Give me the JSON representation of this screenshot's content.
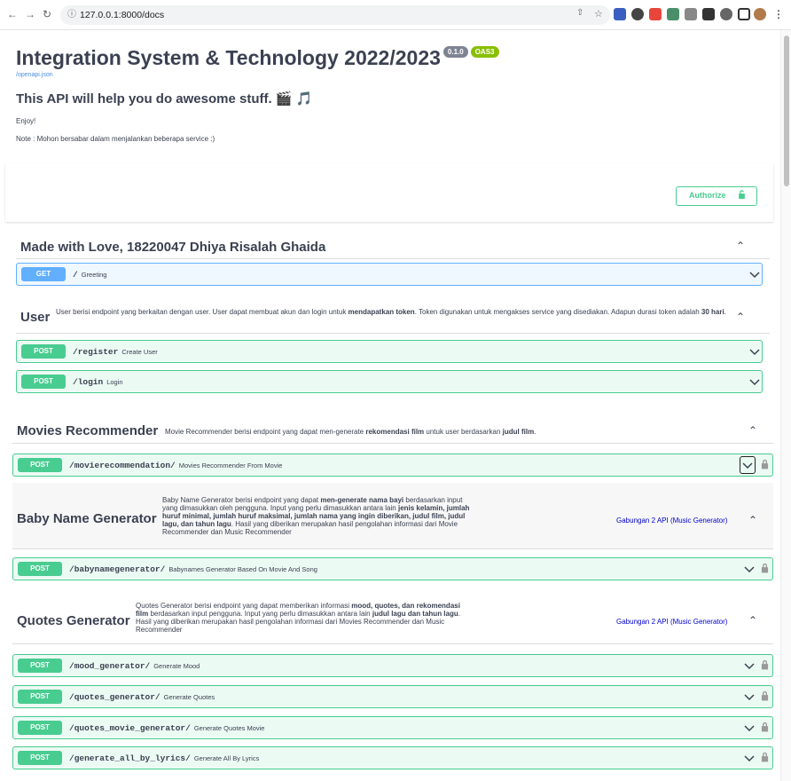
{
  "browser": {
    "url": "127.0.0.1:8000/docs",
    "back_icon": "arrow-left-icon",
    "forward_icon": "arrow-right-icon",
    "reload_icon": "reload-icon"
  },
  "info": {
    "title": "Integration System & Technology 2022/2023",
    "version": "0.1.0",
    "oas": "OAS3",
    "spec_link": "/openapi.json",
    "headline": "This API will help you do awesome stuff. 🎬 🎵",
    "line1": "Enjoy!",
    "line2": "Note : Mohon bersabar dalam menjalankan beberapa service :)"
  },
  "authorize_label": "Authorize",
  "tags": {
    "love": {
      "name": "Made with Love, 18220047 Dhiya Risalah Ghaida"
    },
    "user": {
      "name": "User",
      "desc_a": "User berisi endpoint yang berkaitan dengan user. User dapat membuat akun dan login untuk ",
      "desc_b": "mendapatkan token",
      "desc_c": ". Token digunakan untuk mengakses service yang disediakan. Adapun durasi token adalah ",
      "desc_d": "30 hari",
      "desc_e": "."
    },
    "movies": {
      "name": "Movies Recommender",
      "desc_a": "Movie Recommender berisi endpoint yang dapat men-generate ",
      "desc_b": "rekomendasi film",
      "desc_c": " untuk user berdasarkan ",
      "desc_d": "judul film",
      "desc_e": "."
    },
    "baby": {
      "name": "Baby Name Generator",
      "desc_a": "Baby Name Generator berisi endpoint yang dapat ",
      "desc_b": "men-generate nama bayi",
      "desc_c": " berdasarkan input yang dimasukkan oleh pengguna. Input yang perlu dimasukkan antara lain ",
      "desc_d": "jenis kelamin, jumlah huruf minimal, jumlah huruf maksimal, jumlah nama yang ingin diberikan, judul film, judul lagu, dan tahun lagu",
      "desc_e": ". Hasil yang diberikan merupakan hasil pengolahan informasi dari Movie Recommender dan Music Recommender",
      "link": "Gabungan 2 API (Music Generator)"
    },
    "quotes": {
      "name": "Quotes Generator",
      "desc_a": "Quotes Generator berisi endpoint yang dapat memberikan informasi ",
      "desc_b": "mood, quotes, dan rekomendasi film",
      "desc_c": " berdasarkan input pengguna. Input yang perlu dimasukkan antara lain ",
      "desc_d": "judul lagu dan tahun lagu",
      "desc_e": ". Hasil yang diberikan merupakan hasil pengolahan informasi dari Movies Recommender dan Music Recommender",
      "link": "Gabungan 2 API (Music Generator)"
    }
  },
  "ops": {
    "greeting": {
      "method": "GET",
      "path": "/",
      "summary": "Greeting"
    },
    "register": {
      "method": "POST",
      "path": "/register",
      "summary": "Create User"
    },
    "login": {
      "method": "POST",
      "path": "/login",
      "summary": "Login"
    },
    "movierec": {
      "method": "POST",
      "path": "/movierecommendation/",
      "summary": "Movies Recommender From Movie"
    },
    "babyname": {
      "method": "POST",
      "path": "/babynamegenerator/",
      "summary": "Babynames Generator Based On Movie And Song"
    },
    "mood": {
      "method": "POST",
      "path": "/mood_generator/",
      "summary": "Generate Mood"
    },
    "quotes": {
      "method": "POST",
      "path": "/quotes_generator/",
      "summary": "Generate Quotes"
    },
    "quotesmovie": {
      "method": "POST",
      "path": "/quotes_movie_generator/",
      "summary": "Generate Quotes Movie"
    },
    "lyrics": {
      "method": "POST",
      "path": "/generate_all_by_lyrics/",
      "summary": "Generate All By Lyrics"
    }
  },
  "colors": {
    "get": "#61affe",
    "post": "#49cc90",
    "link": "#4990e2"
  }
}
